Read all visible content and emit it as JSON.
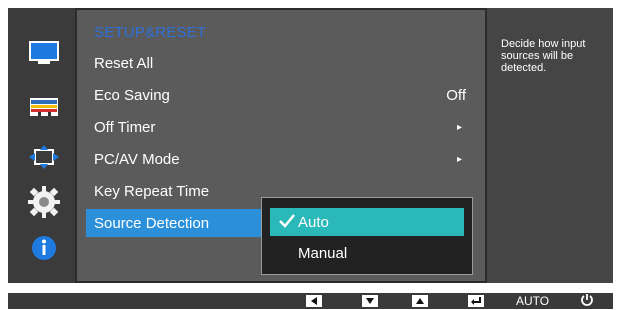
{
  "menu": {
    "title": "SETUP&RESET",
    "items": [
      {
        "label": "Reset All",
        "value": "",
        "arrow": ""
      },
      {
        "label": "Eco Saving",
        "value": "Off",
        "arrow": ""
      },
      {
        "label": "Off Timer",
        "value": "",
        "arrow": "▸"
      },
      {
        "label": "PC/AV Mode",
        "value": "",
        "arrow": "▸"
      },
      {
        "label": "Key Repeat Time",
        "value": "",
        "arrow": ""
      },
      {
        "label": "Source Detection",
        "value": "",
        "arrow": ""
      }
    ],
    "selected_index": 5
  },
  "submenu": {
    "options": [
      "Auto",
      "Manual"
    ],
    "selected_index": 0
  },
  "help": {
    "text": "Decide how input sources will be detected."
  },
  "bottom_bar": {
    "keys": [
      "left-icon",
      "down-icon",
      "up-icon",
      "enter-icon"
    ],
    "auto_label": "AUTO",
    "power_icon": "power-icon"
  },
  "colors": {
    "accent_title": "#2f6fd8",
    "selected_item": "#2b90d9",
    "selected_subitem": "#2bb8b8"
  },
  "icons": [
    "monitor-icon",
    "color-adjust-icon",
    "position-icon",
    "settings-gear-icon",
    "info-icon"
  ]
}
